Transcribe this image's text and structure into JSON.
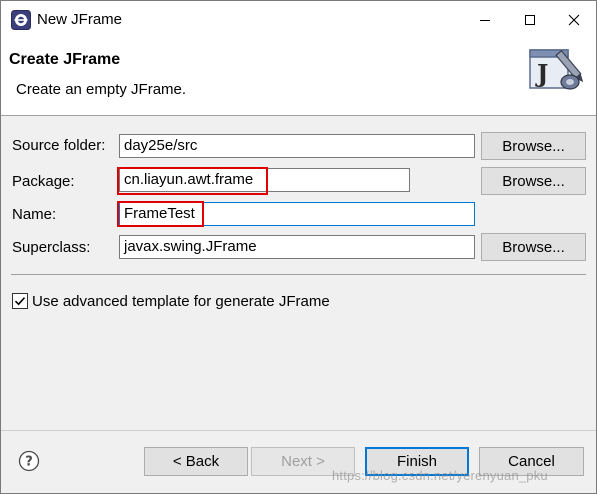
{
  "window": {
    "title": "New JFrame"
  },
  "header": {
    "title": "Create JFrame",
    "description": "Create an empty JFrame.",
    "image_glyph": "J"
  },
  "form": {
    "source_folder": {
      "label": "Source folder:",
      "value": "day25e/src",
      "button_label": "Browse..."
    },
    "package": {
      "label": "Package:",
      "value": "cn.liayun.awt.frame",
      "button_label": "Browse..."
    },
    "name": {
      "label": "Name:",
      "value": "FrameTest"
    },
    "superclass": {
      "label": "Superclass:",
      "value": "javax.swing.JFrame",
      "button_label": "Browse..."
    }
  },
  "options": {
    "advanced_template": {
      "label": "Use advanced template for generate JFrame",
      "checked": true
    }
  },
  "footer": {
    "help_icon": "question-mark",
    "back_label": "< Back",
    "next_label": "Next >",
    "finish_label": "Finish",
    "cancel_label": "Cancel",
    "watermark": "https://blog.csdn.net/yerenyuan_pku"
  },
  "colors": {
    "highlight": "#e00000",
    "focus": "#0078d7",
    "dialog_bg": "#f0f0f0"
  }
}
